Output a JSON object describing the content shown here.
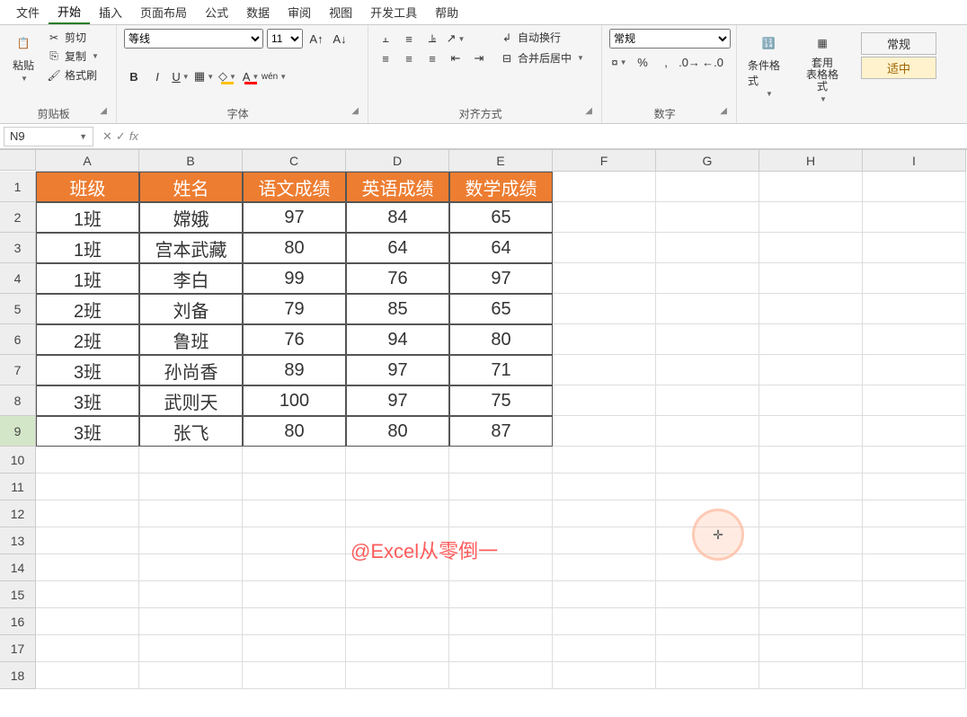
{
  "menu": {
    "file": "文件",
    "home": "开始",
    "insert": "插入",
    "layout": "页面布局",
    "formulas": "公式",
    "data": "数据",
    "review": "审阅",
    "view": "视图",
    "dev": "开发工具",
    "help": "帮助"
  },
  "ribbon": {
    "clipboard": {
      "paste": "粘贴",
      "cut": "剪切",
      "copy": "复制",
      "format_painter": "格式刷",
      "label": "剪贴板"
    },
    "font": {
      "name": "等线",
      "size": "11",
      "bold": "B",
      "italic": "I",
      "underline": "U",
      "label": "字体"
    },
    "align": {
      "wrap": "自动换行",
      "merge": "合并后居中",
      "label": "对齐方式"
    },
    "number": {
      "format": "常规",
      "label": "数字"
    },
    "styles": {
      "cond": "条件格式",
      "table": "套用\n表格格式",
      "normal": "常规",
      "good": "适中"
    }
  },
  "fbar": {
    "name": "N9",
    "fx": "fx"
  },
  "grid": {
    "cols": [
      "A",
      "B",
      "C",
      "D",
      "E",
      "F",
      "G",
      "H",
      "I"
    ],
    "headers": [
      "班级",
      "姓名",
      "语文成绩",
      "英语成绩",
      "数学成绩"
    ],
    "rows": [
      [
        "1班",
        "嫦娥",
        "97",
        "84",
        "65"
      ],
      [
        "1班",
        "宫本武藏",
        "80",
        "64",
        "64"
      ],
      [
        "1班",
        "李白",
        "99",
        "76",
        "97"
      ],
      [
        "2班",
        "刘备",
        "79",
        "85",
        "65"
      ],
      [
        "2班",
        "鲁班",
        "76",
        "94",
        "80"
      ],
      [
        "3班",
        "孙尚香",
        "89",
        "97",
        "71"
      ],
      [
        "3班",
        "武则天",
        "100",
        "97",
        "75"
      ],
      [
        "3班",
        "张飞",
        "80",
        "80",
        "87"
      ]
    ],
    "watermark": "@Excel从零倒一"
  }
}
